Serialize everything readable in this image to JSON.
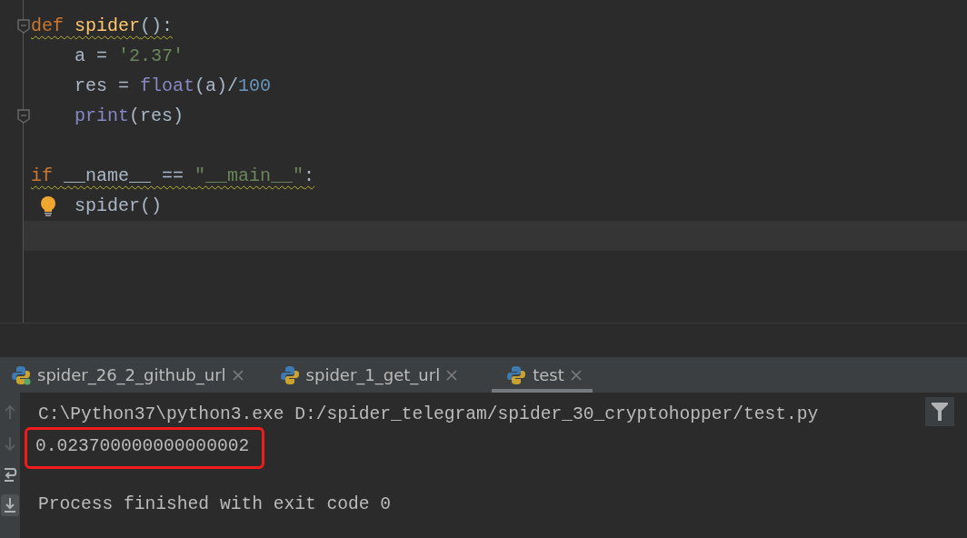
{
  "editor": {
    "lines": [
      {
        "tokens": [
          {
            "kind": "keyword",
            "text": "def "
          },
          {
            "kind": "function",
            "text": "spider"
          },
          {
            "kind": "plain",
            "text": "():"
          }
        ],
        "warning": true,
        "foldable": true,
        "bulb": false,
        "current": false,
        "children": [
          {
            "tokens": [
              {
                "kind": "plain",
                "text": "a = "
              },
              {
                "kind": "string",
                "text": "'2.37'"
              }
            ],
            "warning": false,
            "foldable": false,
            "bulb": false,
            "current": false
          },
          {
            "tokens": [
              {
                "kind": "plain",
                "text": "res = "
              },
              {
                "kind": "builtin",
                "text": "float"
              },
              {
                "kind": "plain",
                "text": "(a)/"
              },
              {
                "kind": "number",
                "text": "100"
              }
            ],
            "warning": false,
            "foldable": false,
            "bulb": false,
            "current": false
          },
          {
            "tokens": [
              {
                "kind": "builtin",
                "text": "print"
              },
              {
                "kind": "plain",
                "text": "(res)"
              }
            ],
            "warning": false,
            "foldable": true,
            "bulb": false,
            "current": false
          }
        ]
      },
      {
        "foldable": false,
        "bulb": false,
        "current": false
      },
      {
        "tokens": [
          {
            "kind": "keyword",
            "text": "if "
          },
          {
            "kind": "plain",
            "text": "__name__ == "
          },
          {
            "kind": "string",
            "text": "\"__main__\""
          },
          {
            "kind": "plain",
            "text": ":"
          }
        ],
        "warning": true,
        "foldable": false,
        "bulb": false,
        "current": false,
        "children": [
          {
            "tokens": [
              {
                "kind": "plain",
                "text": "spider()"
              }
            ],
            "warning": false,
            "foldable": false,
            "bulb": true,
            "current": false
          }
        ]
      },
      {
        "foldable": false,
        "bulb": false,
        "current": true
      }
    ]
  },
  "run_tabs": [
    {
      "label": "spider_26_2_github_url",
      "selected": false,
      "running": true
    },
    {
      "label": "spider_1_get_url",
      "selected": false,
      "running": false
    },
    {
      "label": "test",
      "selected": true,
      "running": false
    }
  ],
  "console": {
    "lines": [
      {
        "text": "C:\\Python37\\python3.exe D:/spider_telegram/spider_30_cryptohopper/test.py",
        "highlighted": false
      },
      {
        "text": "0.023700000000000002",
        "highlighted": true
      },
      {
        "highlighted": false
      },
      {
        "text": "Process finished with exit code 0",
        "highlighted": false
      }
    ]
  },
  "toolbar": [
    {
      "kind": "up",
      "selected": false
    },
    {
      "kind": "down",
      "selected": false
    },
    {
      "kind": "wrap",
      "selected": false
    },
    {
      "kind": "scroll-end",
      "selected": true
    }
  ]
}
